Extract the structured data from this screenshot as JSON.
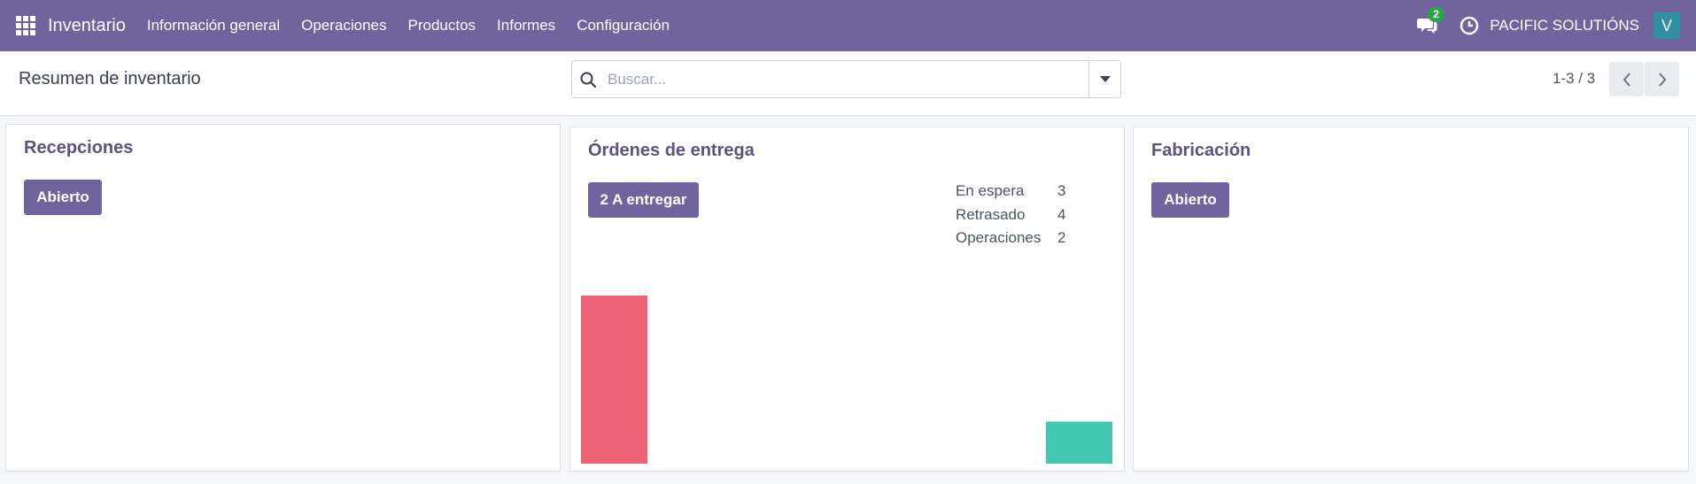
{
  "navbar": {
    "app_name": "Inventario",
    "menu": [
      {
        "label": "Información general"
      },
      {
        "label": "Operaciones"
      },
      {
        "label": "Productos"
      },
      {
        "label": "Informes"
      },
      {
        "label": "Configuración"
      }
    ],
    "messages_count": "2",
    "company": "PACIFIC SOLUTIÓNS",
    "user_initial": "V"
  },
  "control_panel": {
    "title": "Resumen de inventario",
    "search_placeholder": "Buscar...",
    "pager": "1-3 / 3"
  },
  "cards": [
    {
      "title": "Recepciones",
      "button": "Abierto"
    },
    {
      "title": "Órdenes de entrega",
      "button": "2 A entregar",
      "stats": [
        {
          "label": "En espera",
          "value": "3"
        },
        {
          "label": "Retrasado",
          "value": "4"
        },
        {
          "label": "Operaciones",
          "value": "2"
        }
      ],
      "chart_data": {
        "type": "bar",
        "series": [
          {
            "values": [
              4,
              0,
              0,
              0,
              0,
              0,
              0,
              1
            ]
          }
        ],
        "colors": [
          "#ec6175",
          "#ec6175",
          "#ec6175",
          "#ec6175",
          "#ec6175",
          "#ec6175",
          "#ec6175",
          "#44c7b1"
        ],
        "ylim": [
          0,
          4
        ]
      }
    },
    {
      "title": "Fabricación",
      "button": "Abierto"
    }
  ],
  "colors": {
    "navbar": "#71639e",
    "button": "#71639e",
    "title": "#5e5280",
    "badge": "#28a745",
    "avatar": "#2f8fa5",
    "bar_late": "#ec6175",
    "bar_future": "#44c7b1"
  }
}
